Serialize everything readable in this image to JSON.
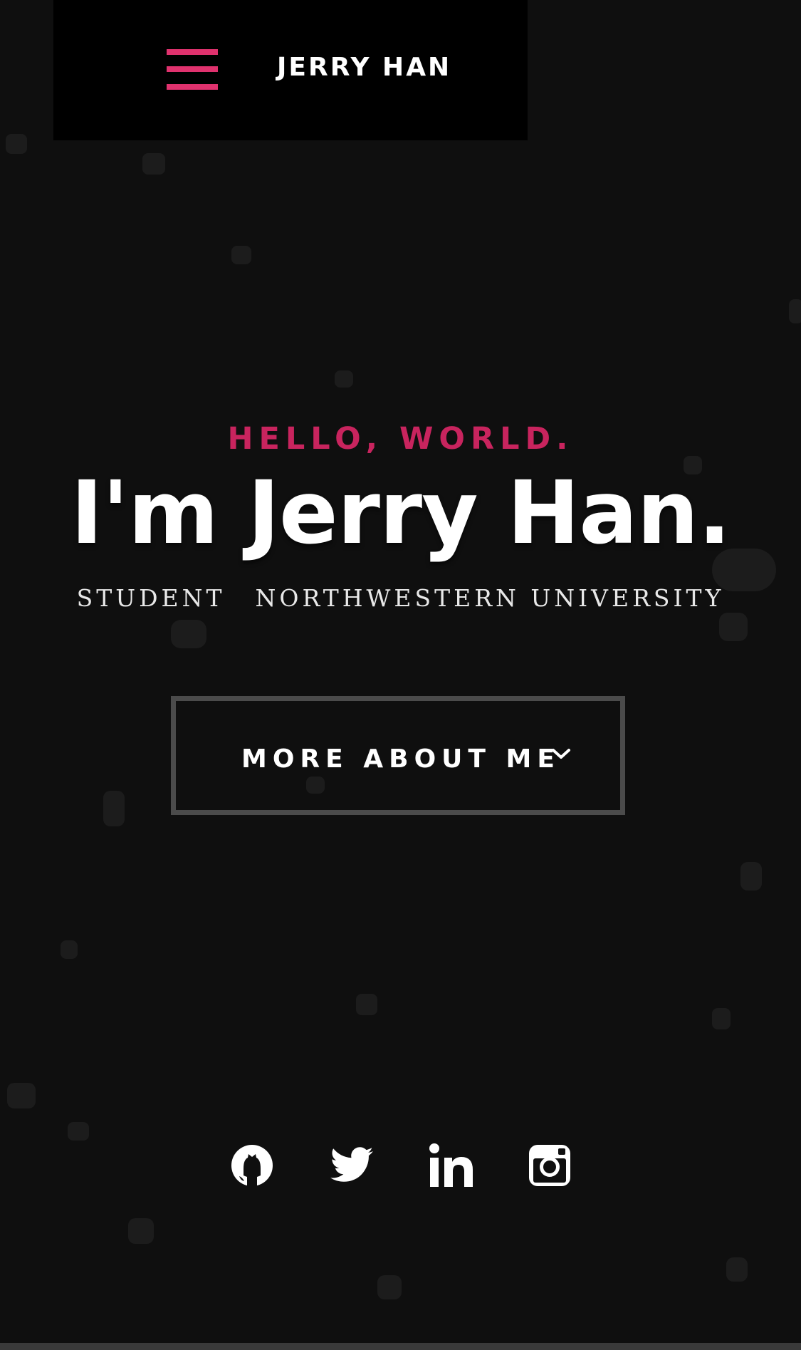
{
  "header": {
    "brand": "JERRY HAN",
    "menu_icon": "hamburger-menu-icon",
    "accent_color": "#e0326e"
  },
  "hero": {
    "greeting": "HELLO, WORLD.",
    "name": "I'm Jerry Han.",
    "role": "STUDENT",
    "school": "NORTHWESTERN UNIVERSITY",
    "cta_label": "MORE ABOUT ME",
    "cta_icon": "chevron-down-icon"
  },
  "social": [
    {
      "name": "GitHub",
      "icon": "github-icon"
    },
    {
      "name": "Twitter",
      "icon": "twitter-icon"
    },
    {
      "name": "LinkedIn",
      "icon": "linkedin-icon"
    },
    {
      "name": "Instagram",
      "icon": "instagram-icon"
    }
  ]
}
